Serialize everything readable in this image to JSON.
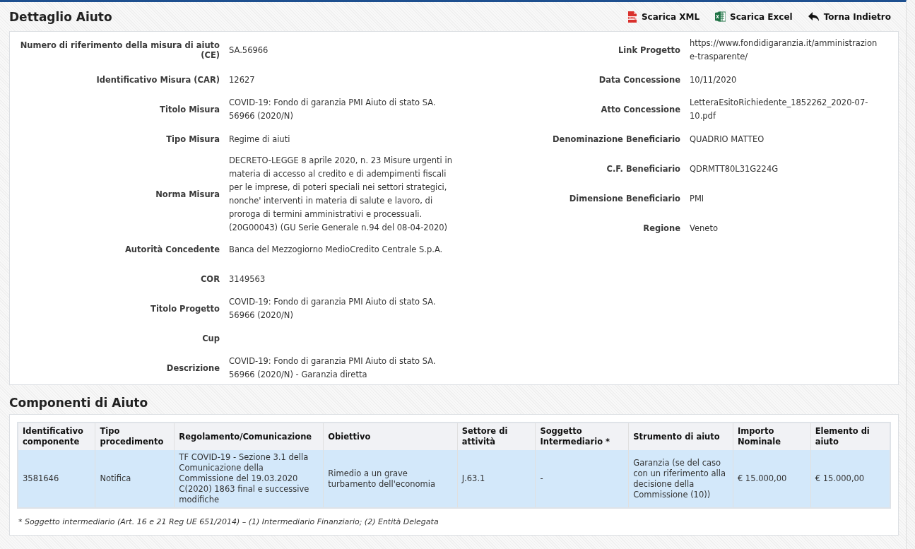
{
  "title": "Dettaglio Aiuto",
  "actions": [
    {
      "kind": "xml",
      "label": "Scarica XML"
    },
    {
      "kind": "excel",
      "label": "Scarica Excel"
    },
    {
      "kind": "back",
      "label": "Torna Indietro"
    }
  ],
  "details_left": [
    {
      "label": "Numero di riferimento della misura di aiuto (CE)",
      "value": "SA.56966"
    },
    {
      "label": "Identificativo Misura (CAR)",
      "value": "12627"
    },
    {
      "label": "Titolo Misura",
      "value": "COVID-19: Fondo di garanzia PMI Aiuto di stato SA. 56966 (2020/N)"
    },
    {
      "label": "Tipo Misura",
      "value": "Regime di aiuti"
    },
    {
      "label": "Norma Misura",
      "value": "DECRETO-LEGGE 8 aprile 2020, n. 23 Misure urgenti in materia di accesso al credito e di adempimenti fiscali per le imprese, di poteri speciali nei settori strategici, nonche' interventi in materia di salute e lavoro, di proroga di termini amministrativi e processuali. (20G00043) (GU Serie Generale n.94 del 08-04-2020)"
    },
    {
      "label": "Autorità Concedente",
      "value": "Banca del Mezzogiorno MedioCredito Centrale S.p.A."
    },
    {
      "label": "COR",
      "value": "3149563"
    },
    {
      "label": "Titolo Progetto",
      "value": "COVID-19: Fondo di garanzia PMI Aiuto di stato SA. 56966 (2020/N)"
    },
    {
      "label": "Cup"
    },
    {
      "label": "Descrizione",
      "value": "COVID-19: Fondo di garanzia PMI Aiuto di stato SA. 56966 (2020/N) - Garanzia diretta"
    }
  ],
  "details_right": [
    {
      "label": "Link Progetto",
      "value": "https://www.fondidigaranzia.it/amministrazione-trasparente/"
    },
    {
      "label": "Data Concessione",
      "value": "10/11/2020"
    },
    {
      "label": "Atto Concessione",
      "value": "LetteraEsitoRichiedente_1852262_2020-07-10.pdf"
    },
    {
      "label": "Denominazione Beneficiario",
      "value": "QUADRIO MATTEO"
    },
    {
      "label": "C.F. Beneficiario",
      "value": "QDRMTT80L31G224G"
    },
    {
      "label": "Dimensione Beneficiario",
      "value": "PMI"
    },
    {
      "label": "Regione",
      "value": "Veneto"
    }
  ],
  "components": {
    "title": "Componenti di Aiuto",
    "columns": [
      "Identificativo componente",
      "Tipo procedimento",
      "Regolamento/Comunicazione",
      "Obiettivo",
      "Settore di attività",
      "Soggetto Intermediario *",
      "Strumento di aiuto",
      "Importo Nominale",
      "Elemento di aiuto"
    ],
    "rows": [
      {
        "selected": true,
        "cells": [
          "3581646",
          "Notifica",
          "TF COVID-19 - Sezione 3.1 della Comunicazione della Commissione del 19.03.2020 C(2020) 1863 final e successive modifiche",
          "Rimedio a un grave turbamento dell'economia",
          "J.63.1",
          "-",
          "Garanzia (se del caso con un riferimento alla decisione della Commissione (10))",
          "€ 15.000,00",
          "€ 15.000,00"
        ]
      }
    ],
    "footnote": "* Soggetto intermediario (Art. 16 e 21 Reg UE 651/2014) – (1) Intermediario Finanziario; (2) Entità Delegata"
  }
}
